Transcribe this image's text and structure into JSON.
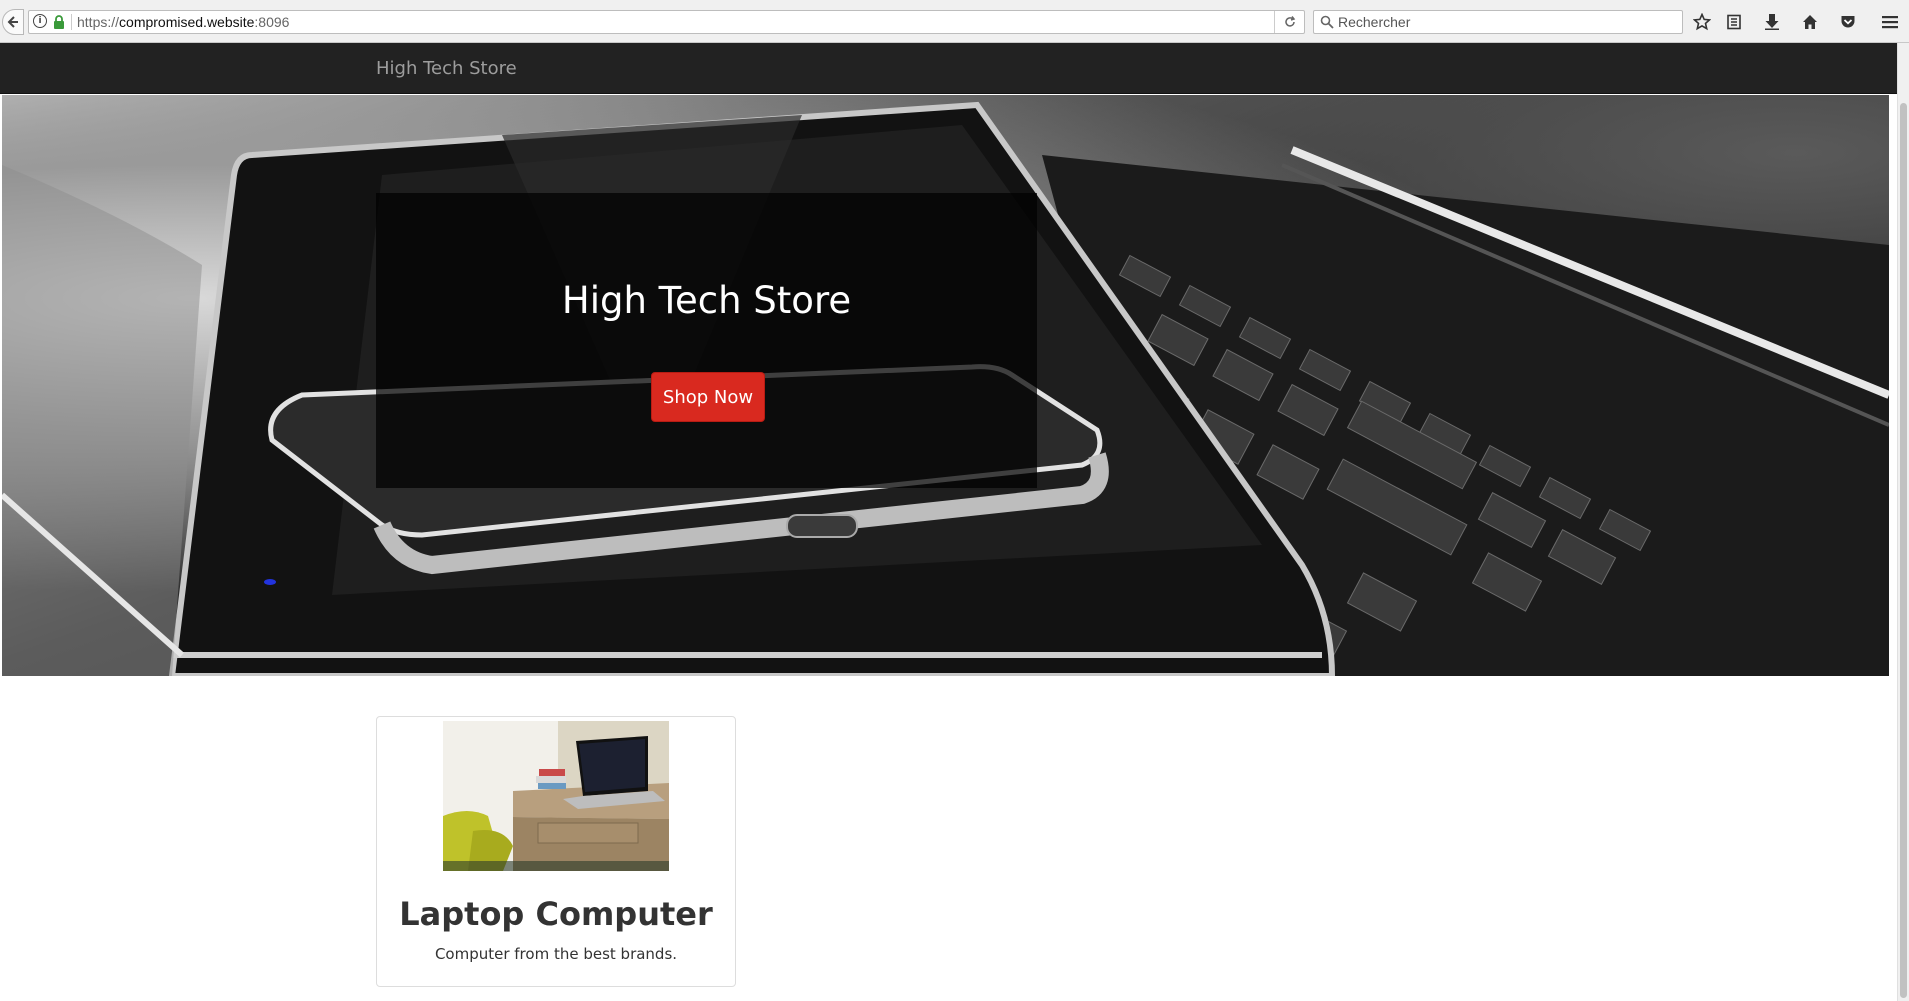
{
  "browser": {
    "url_prefix": "https://",
    "url_host": "compromised.website",
    "url_port": ":8096",
    "search_placeholder": "Rechercher",
    "toolbar_icons": [
      "bookmark-star-icon",
      "reading-list-icon",
      "download-icon",
      "home-icon",
      "pocket-icon",
      "menu-icon"
    ]
  },
  "navbar": {
    "brand": "High Tech Store"
  },
  "hero": {
    "title": "High Tech Store",
    "button_label": "Shop Now"
  },
  "products": [
    {
      "title": "Laptop Computer",
      "description": "Computer from the best brands."
    }
  ],
  "colors": {
    "navbar_bg": "#222222",
    "brand_text": "#9d9d9d",
    "button_bg": "#d9291f",
    "overlay": "rgba(0,0,0,0.72)"
  }
}
